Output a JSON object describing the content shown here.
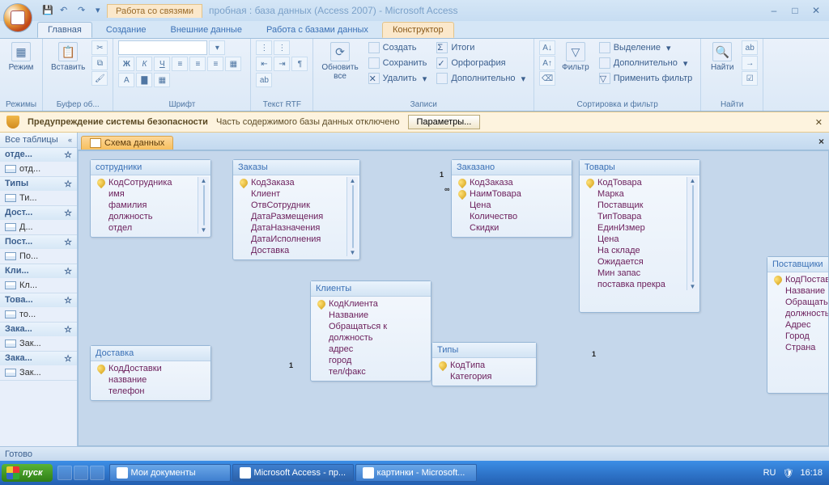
{
  "titlebar": {
    "context_label": "Работа со связями",
    "app_title": "пробная : база данных (Access 2007) - Microsoft Access"
  },
  "tabs": {
    "home": "Главная",
    "create": "Создание",
    "external": "Внешние данные",
    "dbtools": "Работа с базами данных",
    "constructor": "Конструктор"
  },
  "ribbon": {
    "view": "Режим",
    "views_group": "Режимы",
    "paste": "Вставить",
    "clipboard_group": "Буфер об...",
    "font_group": "Шрифт",
    "rtf_group": "Текст RTF",
    "refresh": "Обновить\nвсе",
    "rec_create": "Создать",
    "rec_save": "Сохранить",
    "rec_delete": "Удалить",
    "rec_totals": "Итоги",
    "rec_spell": "Орфография",
    "rec_more": "Дополнительно",
    "records_group": "Записи",
    "filter": "Фильтр",
    "sel": "Выделение",
    "adv": "Дополнительно",
    "toggle_filter": "Применить фильтр",
    "sortfilter_group": "Сортировка и фильтр",
    "find": "Найти",
    "find_group": "Найти"
  },
  "security": {
    "title": "Предупреждение системы безопасности",
    "msg": "Часть содержимого базы данных отключено",
    "params": "Параметры..."
  },
  "nav": {
    "header": "Все таблицы",
    "groups": [
      {
        "name": "отде...",
        "items": [
          "отд..."
        ]
      },
      {
        "name": "Типы",
        "items": [
          "Ти..."
        ]
      },
      {
        "name": "Дост...",
        "items": [
          "Д..."
        ]
      },
      {
        "name": "Пост...",
        "items": [
          "По..."
        ]
      },
      {
        "name": "Кли...",
        "items": [
          "Кл..."
        ]
      },
      {
        "name": "Това...",
        "items": [
          "то..."
        ]
      },
      {
        "name": "Зака...",
        "items": [
          "Зак..."
        ]
      },
      {
        "name": "Зака...",
        "items": [
          "Зак..."
        ]
      }
    ]
  },
  "doc_tab": "Схема данных",
  "tables": {
    "employees": {
      "title": "сотрудники",
      "fields": [
        {
          "n": "КодСотрудника",
          "pk": true
        },
        {
          "n": "имя"
        },
        {
          "n": "фамилия"
        },
        {
          "n": "должность"
        },
        {
          "n": "отдел"
        }
      ]
    },
    "orders": {
      "title": "Заказы",
      "fields": [
        {
          "n": "КодЗаказа",
          "pk": true
        },
        {
          "n": "Клиент"
        },
        {
          "n": "ОтвСотрудник"
        },
        {
          "n": "ДатаРазмещения"
        },
        {
          "n": "ДатаНазначения"
        },
        {
          "n": "ДатаИсполнения"
        },
        {
          "n": "Доставка"
        }
      ]
    },
    "ordered": {
      "title": "Заказано",
      "fields": [
        {
          "n": "КодЗаказа",
          "pk": true
        },
        {
          "n": "НаимТовара",
          "pk": true
        },
        {
          "n": "Цена"
        },
        {
          "n": "Количество"
        },
        {
          "n": "Скидки"
        }
      ]
    },
    "goods": {
      "title": "Товары",
      "fields": [
        {
          "n": "КодТовара",
          "pk": true
        },
        {
          "n": "Марка"
        },
        {
          "n": "Поставщик"
        },
        {
          "n": "ТипТовара"
        },
        {
          "n": "ЕдинИзмер"
        },
        {
          "n": "Цена"
        },
        {
          "n": "На складе"
        },
        {
          "n": "Ожидается"
        },
        {
          "n": "Мин запас"
        },
        {
          "n": "поставка прекра"
        }
      ]
    },
    "clients": {
      "title": "Клиенты",
      "fields": [
        {
          "n": "КодКлиента",
          "pk": true
        },
        {
          "n": "Название"
        },
        {
          "n": "Обращаться к"
        },
        {
          "n": "должность"
        },
        {
          "n": "адрес"
        },
        {
          "n": "город"
        },
        {
          "n": "тел/факс"
        }
      ]
    },
    "delivery": {
      "title": "Доставка",
      "fields": [
        {
          "n": "КодДоставки",
          "pk": true
        },
        {
          "n": "название"
        },
        {
          "n": "телефон"
        }
      ]
    },
    "types": {
      "title": "Типы",
      "fields": [
        {
          "n": "КодТипа",
          "pk": true
        },
        {
          "n": "Категория"
        }
      ]
    },
    "suppliers": {
      "title": "Поставщики",
      "fields": [
        {
          "n": "КодПоставщика",
          "pk": true
        },
        {
          "n": "Название"
        },
        {
          "n": "Обращаться к"
        },
        {
          "n": "должность"
        },
        {
          "n": "Адрес"
        },
        {
          "n": "Город"
        },
        {
          "n": "Страна"
        }
      ]
    }
  },
  "rel_one": "1",
  "rel_many": "∞",
  "status": "Готово",
  "taskbar": {
    "start": "пуск",
    "docs": "Мои документы",
    "access": "Microsoft Access - пр...",
    "paint": "картинки - Microsoft...",
    "lang": "RU",
    "clock": "16:18"
  }
}
